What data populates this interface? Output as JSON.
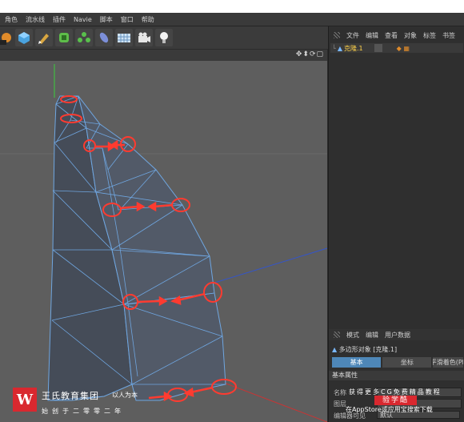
{
  "menubar": {
    "items": [
      "角色",
      "流水线",
      "插件",
      "Navie",
      "脚本",
      "窗口",
      "帮助"
    ]
  },
  "toolbar": {
    "icons": [
      "render-settings-icon",
      "cube-icon",
      "pen-icon",
      "subdivision-icon",
      "cloner-icon",
      "deformer-icon",
      "floor-icon",
      "camera-icon",
      "light-icon"
    ]
  },
  "viewport": {
    "nav_icons": "✥⬍⟳▢"
  },
  "object_manager": {
    "menu": [
      "文件",
      "编辑",
      "查看",
      "对象",
      "标签",
      "书签"
    ],
    "object_name": "克隆.1"
  },
  "attribute_manager": {
    "menu": [
      "模式",
      "编辑",
      "用户数据"
    ],
    "object_title": "多边形对象 [克隆.1]",
    "tabs": [
      "基本",
      "坐标",
      "平滑着色(Ph"
    ],
    "section": "基本属性",
    "fields": [
      {
        "label": "名称",
        "value": ""
      },
      {
        "label": "图层",
        "value": ""
      },
      {
        "label": "编辑器可见",
        "value": "默认"
      }
    ]
  },
  "watermark": {
    "logo_char": "W",
    "company": "王氏教育集团",
    "slogan": "以人为本",
    "line2": "始创于二零零二年"
  },
  "promo": {
    "line1": "获得更多CG免费精品教程",
    "badge": "验学酷",
    "line3": "在AppStore或应用宝搜索下载"
  },
  "colors": {
    "accent": "#4e87b8",
    "annotation": "#ff3b30",
    "mesh_fill": "#4b5260",
    "mesh_edge": "#6fa6e0",
    "viewport_bg": "#5e5e5e"
  }
}
